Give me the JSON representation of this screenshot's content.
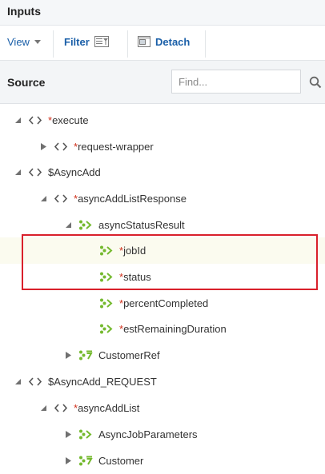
{
  "panel": {
    "title": "Inputs"
  },
  "toolbar": {
    "view_label": "View",
    "filter_label": "Filter",
    "detach_label": "Detach"
  },
  "source": {
    "label": "Source",
    "find_placeholder": "Find..."
  },
  "tree": [
    {
      "id": "execute",
      "prefix": "*",
      "label": "execute",
      "icon": "element-icon",
      "expanded": true
    },
    {
      "id": "request-wrapper",
      "prefix": "*",
      "label": "request-wrapper",
      "icon": "element-icon",
      "expanded": false
    },
    {
      "id": "asyncadd",
      "prefix": "",
      "label": "$AsyncAdd",
      "icon": "element-icon",
      "expanded": true
    },
    {
      "id": "asyncaddlistresponse",
      "prefix": "*",
      "label": "asyncAddListResponse",
      "icon": "element-icon",
      "expanded": true
    },
    {
      "id": "asyncstatusresult",
      "prefix": "",
      "label": "asyncStatusResult",
      "icon": "complex-type-icon",
      "expanded": true
    },
    {
      "id": "jobid",
      "prefix": "*",
      "label": "jobId",
      "icon": "complex-type-icon"
    },
    {
      "id": "status",
      "prefix": "*",
      "label": "status",
      "icon": "complex-type-icon"
    },
    {
      "id": "percentcompleted",
      "prefix": "*",
      "label": "percentCompleted",
      "icon": "complex-type-icon"
    },
    {
      "id": "estremainingduration",
      "prefix": "*",
      "label": "estRemainingDuration",
      "icon": "complex-type-icon"
    },
    {
      "id": "customerref",
      "prefix": "",
      "label": "CustomerRef",
      "icon": "record-list-icon",
      "expanded": false
    },
    {
      "id": "asyncadd-request",
      "prefix": "",
      "label": "$AsyncAdd_REQUEST",
      "icon": "element-icon",
      "expanded": true
    },
    {
      "id": "asyncaddlist",
      "prefix": "*",
      "label": "asyncAddList",
      "icon": "element-icon",
      "expanded": true
    },
    {
      "id": "asyncjobparameters",
      "prefix": "",
      "label": "AsyncJobParameters",
      "icon": "complex-type-icon",
      "expanded": false
    },
    {
      "id": "customer",
      "prefix": "",
      "label": "Customer",
      "icon": "record-list-icon",
      "expanded": false
    }
  ],
  "highlight": {
    "rows": [
      "jobId",
      "status"
    ],
    "color": "#d9202b"
  },
  "colors": {
    "link": "#1a5fa8",
    "required_star": "#d0301b",
    "icon_green": "#74b92e",
    "selected_row_bg": "#fbfbef"
  }
}
